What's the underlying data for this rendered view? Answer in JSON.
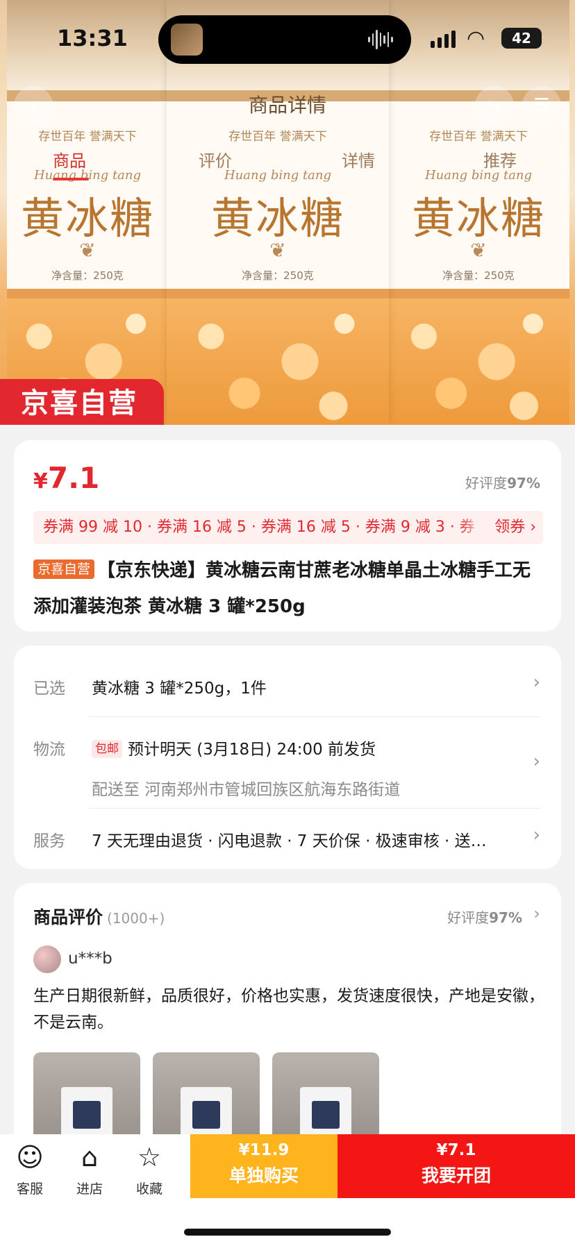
{
  "status_bar": {
    "time": "13:31",
    "battery": "42"
  },
  "hero": {
    "nav_title": "商品详情",
    "tabs": [
      "商品",
      "评价",
      "详情",
      "推荐"
    ],
    "active_tab": "商品",
    "jar_subtitle": "存世百年 誉满天下",
    "jar_pinyin": "Huang bing tang",
    "jar_name": "黄冰糖",
    "jar_net": "净含量：250克",
    "banner": "京喜自营"
  },
  "price_card": {
    "currency": "¥",
    "price": "7.1",
    "rating_label": "好评度",
    "rating_value": "97%",
    "coupons": "券满 99 减 10 · 券满 16 减 5 · 券满 16 减 5 · 券满 9 减 3 · 券",
    "coupon_action": "领券 ›",
    "title_tag": "京喜自营",
    "title": "【京东快递】黄冰糖云南甘蔗老冰糖单晶土冰糖手工无添加灌装泡茶 黄冰糖 3 罐*250g"
  },
  "spec_card": {
    "selected_label": "已选",
    "selected_value": "黄冰糖 3 罐*250g，1件",
    "logistics_label": "物流",
    "free_shipping": "包邮",
    "ship_time": "预计明天 (3月18日) 24:00 前发货",
    "address": "配送至 河南郑州市管城回族区航海东路街道",
    "service_label": "服务",
    "service_value": "7 天无理由退货 · 闪电退款 · 7 天价保 · 极速审核 · 送…"
  },
  "review_card": {
    "title": "商品评价",
    "count": "(1000+)",
    "rating_label": "好评度",
    "rating_value": "97%",
    "user": "u***b",
    "body": "生产日期很新鲜，品质很好，价格也实惠，发货速度很快，产地是安徽，不是云南。"
  },
  "bottom_bar": {
    "service": "客服",
    "store": "进店",
    "favorite": "收藏",
    "alone_price": "¥11.9",
    "alone_label": "单独购买",
    "group_price": "¥7.1",
    "group_label": "我要开团"
  },
  "colors": {
    "brand_red": "#e3272e",
    "buy_alone": "#ffb41e",
    "buy_group": "#f41515"
  }
}
